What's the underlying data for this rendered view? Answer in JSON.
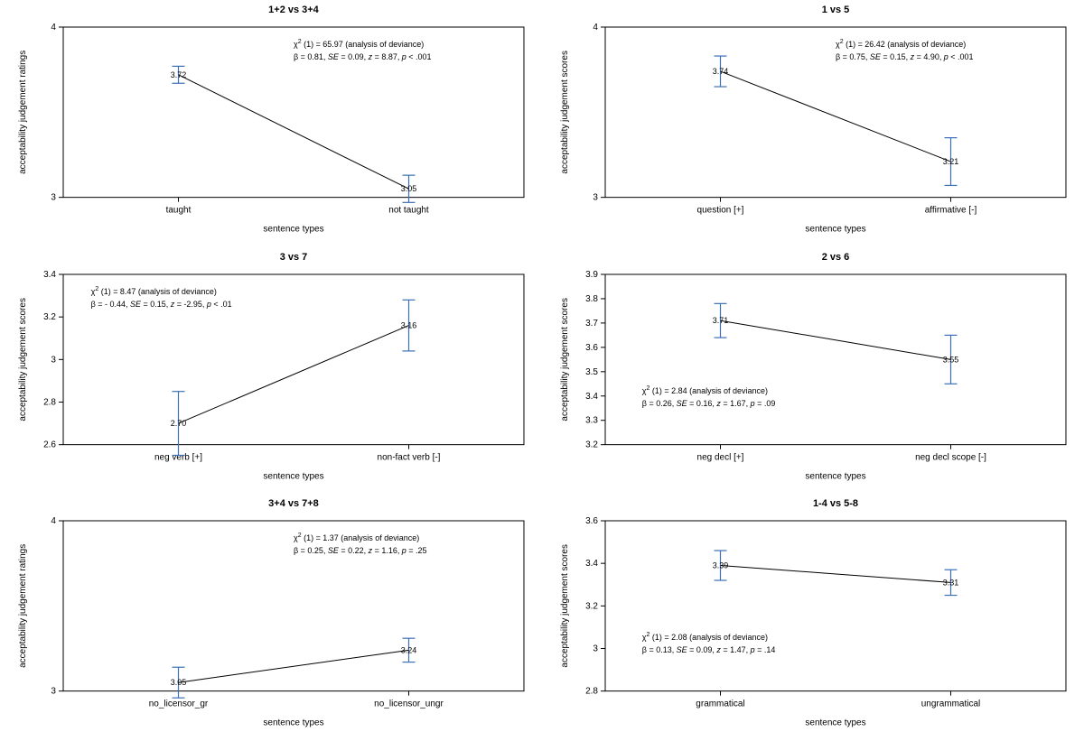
{
  "chart_data": [
    {
      "id": "p0",
      "type": "line",
      "title": "1+2 vs 3+4",
      "xlabel": "sentence types",
      "ylabel": "acceptability judgement ratings",
      "categories": [
        "taught",
        "not taught"
      ],
      "ylim": [
        3,
        4
      ],
      "yticks": [
        3,
        4
      ],
      "series": [
        {
          "values": [
            3.72,
            3.05
          ],
          "err": [
            0.05,
            0.08
          ]
        }
      ],
      "chi2_df": 1,
      "chi2": 65.97,
      "chi2_note": "(analysis of deviance)",
      "beta": "0.81",
      "se": "0.09",
      "z": "8.87",
      "p": "< .001",
      "stats_pos": "right"
    },
    {
      "id": "p1",
      "type": "line",
      "title": "1 vs 5",
      "xlabel": "sentence types",
      "ylabel": "acceptability judgement scores",
      "categories": [
        "question [+]",
        "affirmative [-]"
      ],
      "ylim": [
        3,
        4
      ],
      "yticks": [
        3,
        4
      ],
      "series": [
        {
          "values": [
            3.74,
            3.21
          ],
          "err": [
            0.09,
            0.14
          ]
        }
      ],
      "chi2_df": 1,
      "chi2": 26.42,
      "chi2_note": "(analysis of deviance)",
      "beta": "0.75",
      "se": "0.15",
      "z": "4.90",
      "p": "< .001",
      "stats_pos": "right"
    },
    {
      "id": "p2",
      "type": "line",
      "title": "3 vs 7",
      "xlabel": "sentence types",
      "ylabel": "acceptability judgement scores",
      "categories": [
        "neg verb [+]",
        "non-fact verb [-]"
      ],
      "ylim": [
        2.6,
        3.4
      ],
      "yticks": [
        2.6,
        2.8,
        3.0,
        3.2,
        3.4
      ],
      "series": [
        {
          "values": [
            2.7,
            3.16
          ],
          "err": [
            0.15,
            0.12
          ]
        }
      ],
      "chi2_df": 1,
      "chi2": 8.47,
      "chi2_note": "(analysis of deviance)",
      "beta": "- 0.44",
      "se": "0.15",
      "z": "-2.95",
      "p": "< .01",
      "stats_pos": "left"
    },
    {
      "id": "p3",
      "type": "line",
      "title": "2 vs 6",
      "xlabel": "sentence types",
      "ylabel": "acceptability judgement scores",
      "categories": [
        "neg decl [+]",
        "neg decl scope [-]"
      ],
      "ylim": [
        3.2,
        3.9
      ],
      "yticks": [
        3.2,
        3.3,
        3.4,
        3.5,
        3.6,
        3.7,
        3.8,
        3.9
      ],
      "series": [
        {
          "values": [
            3.71,
            3.55
          ],
          "err": [
            0.07,
            0.1
          ]
        }
      ],
      "chi2_df": 1,
      "chi2": 2.84,
      "chi2_note": "(analysis of deviance)",
      "beta": "0.26",
      "se": "0.16",
      "z": "1.67",
      "p": "= .09",
      "stats_pos": "left-low"
    },
    {
      "id": "p4",
      "type": "line",
      "title": "3+4 vs 7+8",
      "xlabel": "sentence types",
      "ylabel": "acceptability judgement ratings",
      "categories": [
        "no_licensor_gr",
        "no_licensor_ungr"
      ],
      "ylim": [
        3,
        4
      ],
      "yticks": [
        3,
        4
      ],
      "series": [
        {
          "values": [
            3.05,
            3.24
          ],
          "err": [
            0.09,
            0.07
          ]
        }
      ],
      "chi2_df": 1,
      "chi2": 1.37,
      "chi2_note": "(analysis of deviance)",
      "beta": "0.25",
      "se": "0.22",
      "z": "1.16",
      "p": "= .25",
      "stats_pos": "right"
    },
    {
      "id": "p5",
      "type": "line",
      "title": "1-4 vs 5-8",
      "xlabel": "sentence types",
      "ylabel": "acceptability judgement scores",
      "categories": [
        "grammatical",
        "ungrammatical"
      ],
      "ylim": [
        2.8,
        3.6
      ],
      "yticks": [
        2.8,
        3.0,
        3.2,
        3.4,
        3.6
      ],
      "series": [
        {
          "values": [
            3.39,
            3.31
          ],
          "err": [
            0.07,
            0.06
          ]
        }
      ],
      "chi2_df": 1,
      "chi2": 2.08,
      "chi2_note": "(analysis of deviance)",
      "beta": "0.13",
      "se": "0.09",
      "z": "1.47",
      "p": "= .14",
      "stats_pos": "left-low"
    }
  ]
}
